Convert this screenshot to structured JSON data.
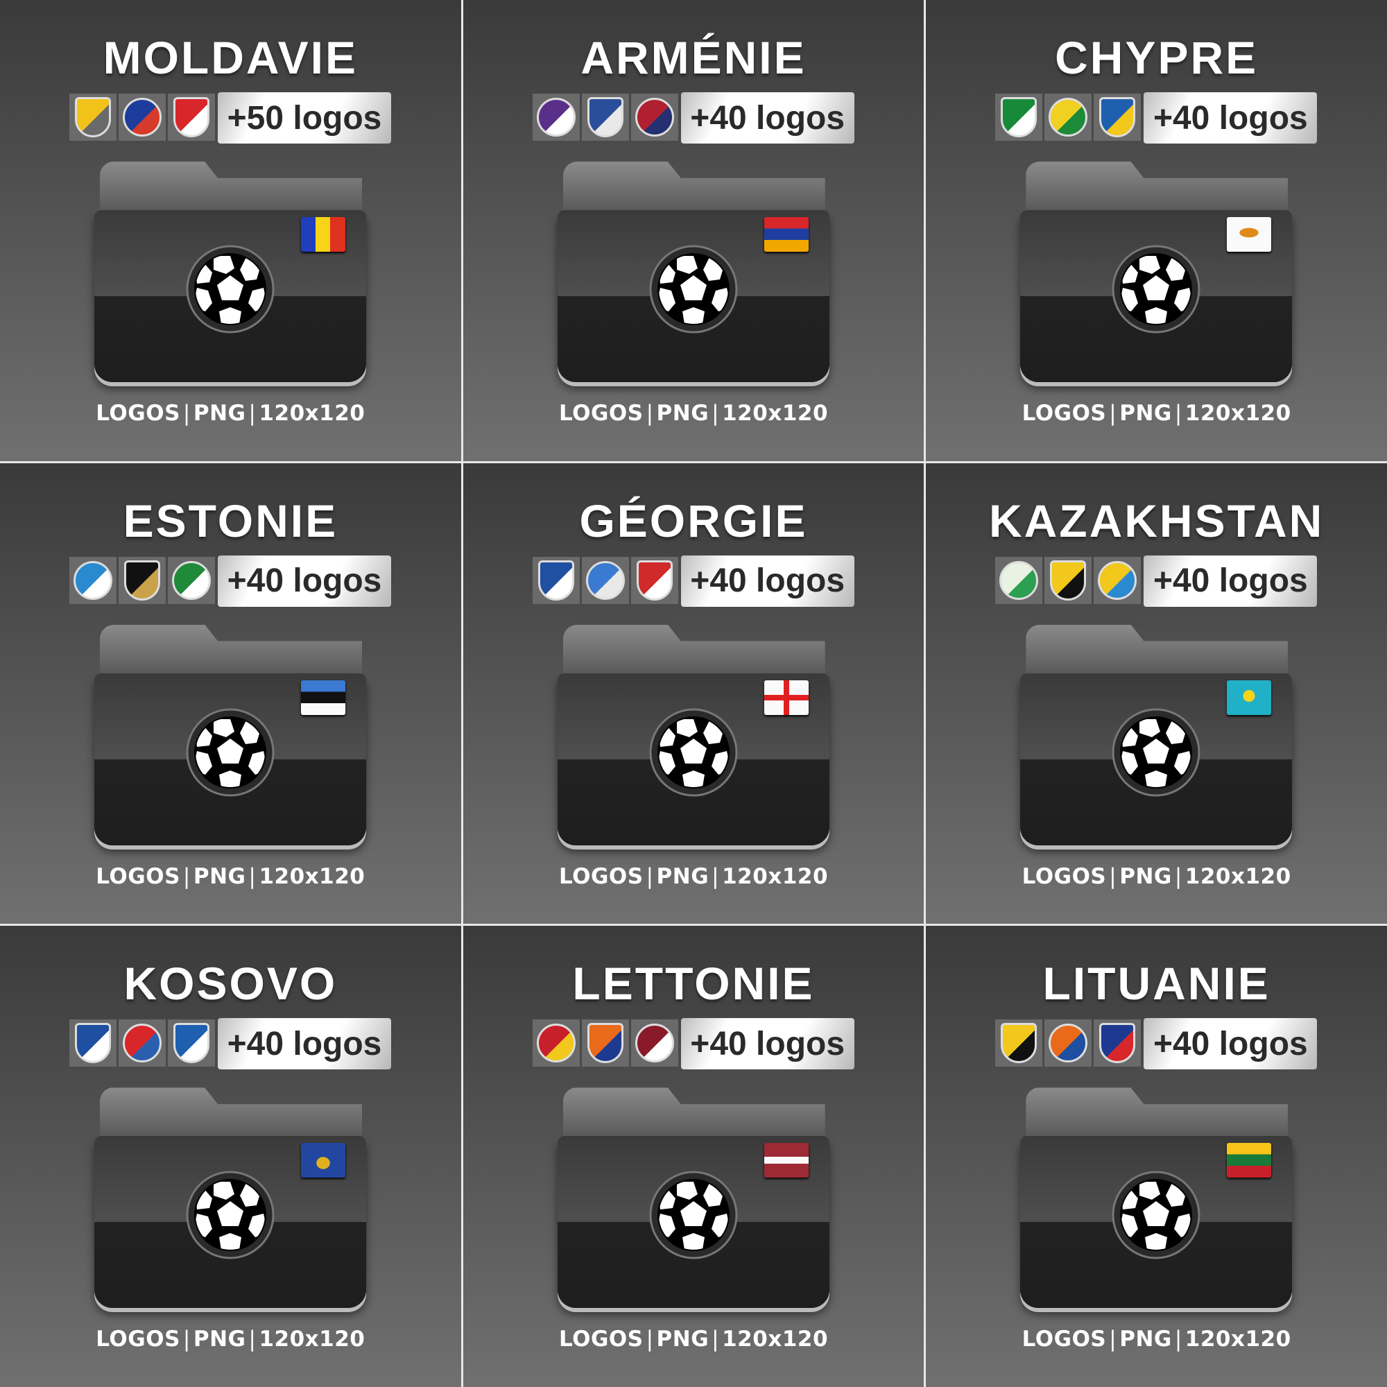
{
  "footer": {
    "a": "LOGOS",
    "b": "PNG",
    "c": "120x120",
    "sep": "|"
  },
  "cards": [
    {
      "title": "MOLDAVIE",
      "count": "+50 logos",
      "flag": "moldova",
      "logos": [
        [
          "#f2c21a",
          "#6a6a6a"
        ],
        [
          "#1d3c9c",
          "#d63a2a"
        ],
        [
          "#d8262a",
          "#fff"
        ]
      ]
    },
    {
      "title": "ARMÉNIE",
      "count": "+40 logos",
      "flag": "armenia",
      "logos": [
        [
          "#5a2f8a",
          "#fff"
        ],
        [
          "#2a4f9a",
          "#e9e9e9"
        ],
        [
          "#b02030",
          "#243070"
        ]
      ]
    },
    {
      "title": "CHYPRE",
      "count": "+40 logos",
      "flag": "cyprus",
      "logos": [
        [
          "#178a3a",
          "#fff"
        ],
        [
          "#f0d020",
          "#1d8a3a"
        ],
        [
          "#1e5fb0",
          "#f2c81c"
        ]
      ]
    },
    {
      "title": "ESTONIE",
      "count": "+40 logos",
      "flag": "estonia",
      "logos": [
        [
          "#2a8ad0",
          "#fff"
        ],
        [
          "#111",
          "#c9a24a"
        ],
        [
          "#1e8a3a",
          "#fff"
        ]
      ]
    },
    {
      "title": "GÉORGIE",
      "count": "+40 logos",
      "flag": "georgia",
      "logos": [
        [
          "#2050a0",
          "#fff"
        ],
        [
          "#3a7ad0",
          "#e9e9e9"
        ],
        [
          "#d02a2a",
          "#fff"
        ]
      ]
    },
    {
      "title": "KAZAKHSTAN",
      "count": "+40 logos",
      "flag": "kazakhstan",
      "logos": [
        [
          "#e9f3e3",
          "#2aa050"
        ],
        [
          "#f2c81c",
          "#111"
        ],
        [
          "#f2c81c",
          "#2a8ad0"
        ]
      ]
    },
    {
      "title": "KOSOVO",
      "count": "+40 logos",
      "flag": "kosovo",
      "logos": [
        [
          "#1e4fa0",
          "#fff"
        ],
        [
          "#d8262a",
          "#2a5fb0"
        ],
        [
          "#1e5fb0",
          "#fff"
        ]
      ]
    },
    {
      "title": "LETTONIE",
      "count": "+40 logos",
      "flag": "latvia",
      "logos": [
        [
          "#c8202a",
          "#f2c81c"
        ],
        [
          "#e96a1a",
          "#1e3a90"
        ],
        [
          "#8a1a2a",
          "#fff"
        ]
      ]
    },
    {
      "title": "LITUANIE",
      "count": "+40 logos",
      "flag": "lithuania",
      "logos": [
        [
          "#f2c81c",
          "#111"
        ],
        [
          "#e96a1a",
          "#1e4fa0"
        ],
        [
          "#1e3a90",
          "#d8262a"
        ]
      ]
    }
  ]
}
